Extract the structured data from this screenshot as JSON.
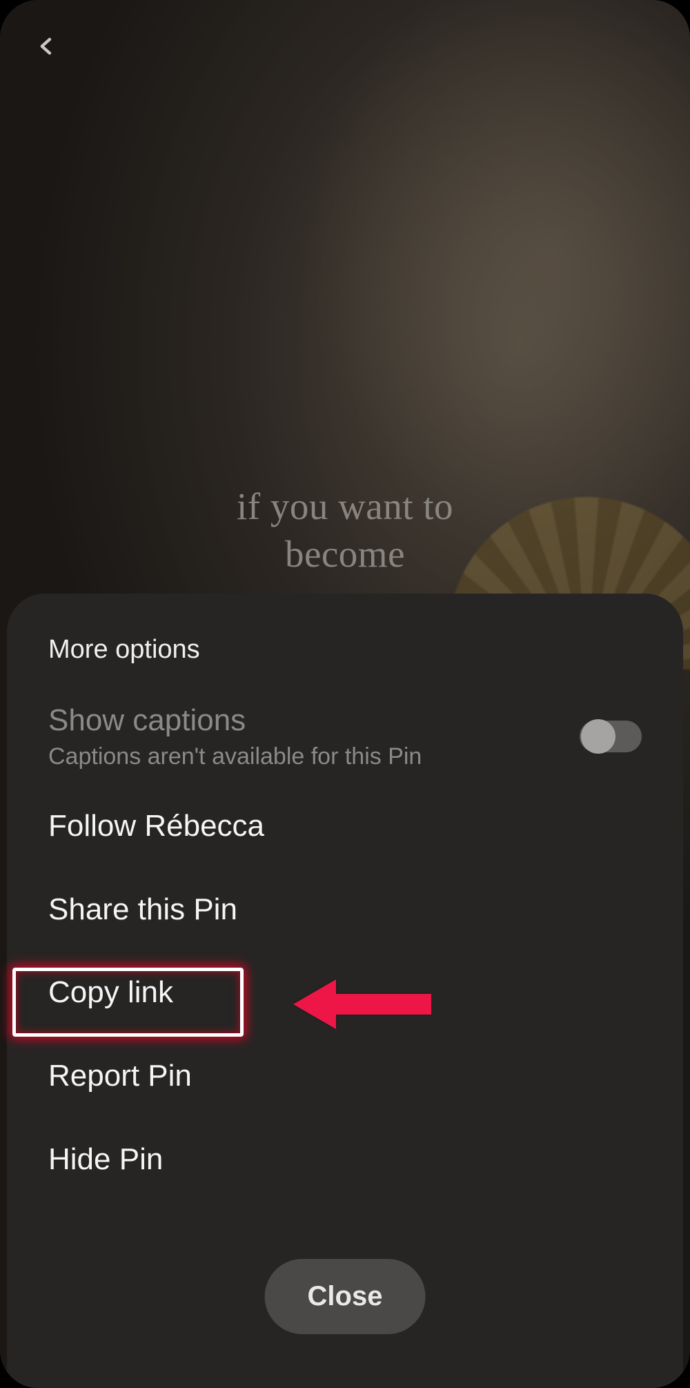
{
  "video": {
    "caption_line1": "if you want to",
    "caption_line2": "become"
  },
  "sheet": {
    "title": "More options",
    "captions": {
      "label": "Show captions",
      "sublabel": "Captions aren't available for this Pin",
      "enabled": false
    },
    "items": {
      "follow": "Follow Rébecca",
      "share": "Share this Pin",
      "copy": "Copy link",
      "report": "Report Pin",
      "hide": "Hide Pin"
    },
    "close": "Close"
  },
  "annotation": {
    "highlight_target": "copy-link"
  }
}
